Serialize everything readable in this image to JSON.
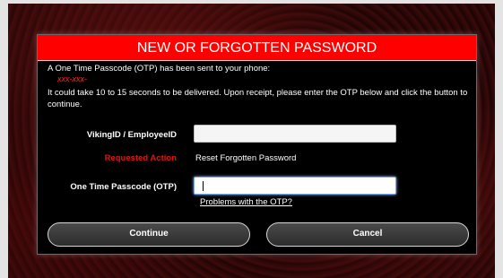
{
  "dialog": {
    "title": "NEW OR FORGOTTEN PASSWORD",
    "otp_sent_text": "A One Time Passcode (OTP) has been sent to your phone:",
    "masked_phone": "xxx-xxx-",
    "instructions": "It could take 10 to 15 seconds to be delivered. Upon receipt, please enter the OTP below and click the button to continue.",
    "viking_id_label": "VikingID / EmployeeID",
    "viking_id_value": "",
    "requested_action_label": "Requested Action",
    "requested_action_value": "Reset Forgotten Password",
    "otp_label": "One Time Passcode (OTP)",
    "otp_value": "",
    "otp_help_link": "Problems with the OTP?",
    "continue_label": "Continue",
    "cancel_label": "Cancel"
  },
  "colors": {
    "title_bar": "#fe0000",
    "dialog_bg": "#000000",
    "requested_action_label": "#e31212",
    "masked_phone": "#ff2a2a"
  }
}
